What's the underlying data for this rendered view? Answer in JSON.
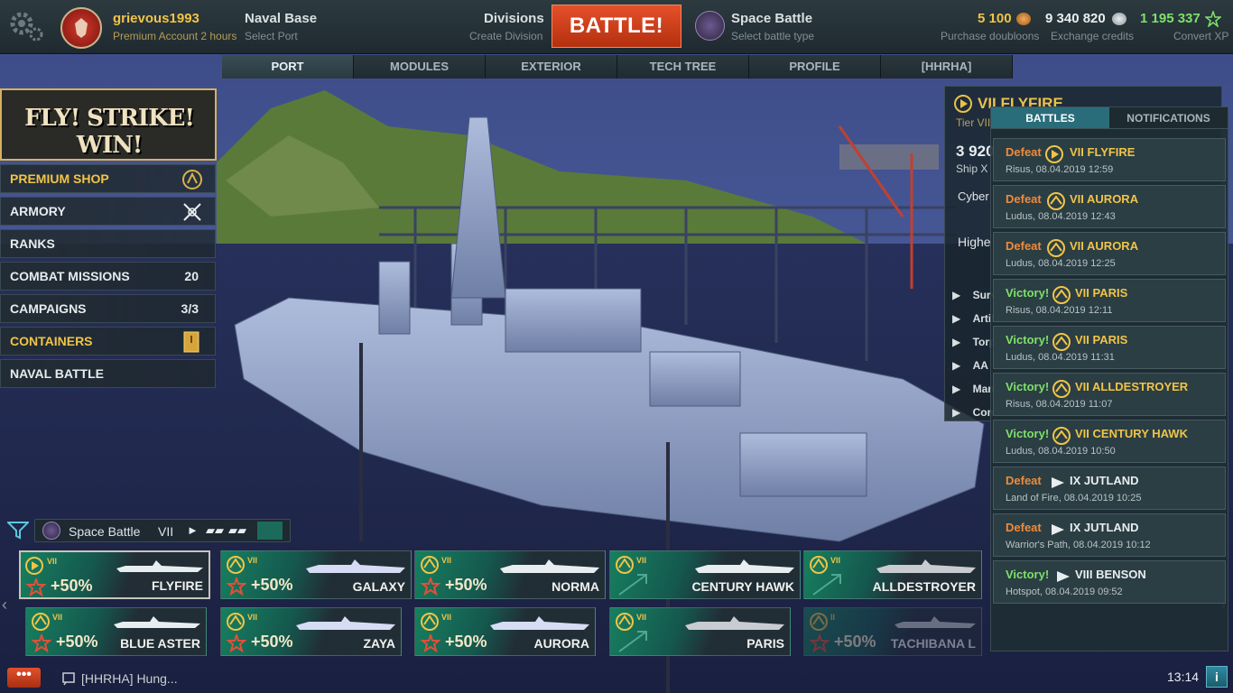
{
  "header": {
    "username": "grievous1993",
    "account_status": "Premium Account 2 hours",
    "port_name": "Naval Base",
    "port_sub": "Select Port",
    "divisions_label": "Divisions",
    "divisions_sub": "Create Division",
    "battle_label": "BATTLE!",
    "battle_type": "Space Battle",
    "battle_type_sub": "Select battle type",
    "doubloons": "5 100",
    "doubloons_label": "Purchase doubloons",
    "credits": "9 340 820",
    "credits_label": "Exchange credits",
    "free_xp": "1 195 337",
    "free_xp_label": "Convert XP"
  },
  "tabs": [
    "PORT",
    "MODULES",
    "EXTERIOR",
    "TECH TREE",
    "PROFILE",
    "[HHRHA]"
  ],
  "promo": {
    "text": "FLY! STRIKE! WIN!"
  },
  "menu": [
    {
      "label": "PREMIUM SHOP",
      "icon": "premium-icon"
    },
    {
      "label": "ARMORY",
      "icon": "armory-icon"
    },
    {
      "label": "RANKS"
    },
    {
      "label": "COMBAT MISSIONS",
      "count": "20"
    },
    {
      "label": "CAMPAIGNS",
      "count": "3/3"
    },
    {
      "label": "CONTAINERS",
      "icon": "container-icon"
    },
    {
      "label": "NAVAL BATTLE"
    }
  ],
  "ship_info": {
    "name": "VII FLYFIRE",
    "tier_text": "Tier VII destro",
    "xp": "3 920",
    "ship_xp_label": "Ship X",
    "commander": "Cyber",
    "highest": "Highe",
    "modules": [
      "Surv",
      "Artil",
      "Torp",
      "AA",
      "Man",
      "Con"
    ]
  },
  "history": {
    "tabs": [
      "BATTLES",
      "NOTIFICATIONS"
    ],
    "rows": [
      {
        "result": "Defeat",
        "ship": "VII FLYFIRE",
        "meta": "Risus, 08.04.2019 12:59"
      },
      {
        "result": "Defeat",
        "ship": "VII AURORA",
        "meta": "Ludus, 08.04.2019 12:43"
      },
      {
        "result": "Defeat",
        "ship": "VII AURORA",
        "meta": "Ludus, 08.04.2019 12:25"
      },
      {
        "result": "Victory!",
        "ship": "VII PARIS",
        "meta": "Risus, 08.04.2019 12:11"
      },
      {
        "result": "Victory!",
        "ship": "VII PARIS",
        "meta": "Ludus, 08.04.2019 11:31"
      },
      {
        "result": "Victory!",
        "ship": "VII ALLDESTROYER",
        "meta": "Risus, 08.04.2019 11:07"
      },
      {
        "result": "Victory!",
        "ship": "VII CENTURY HAWK",
        "meta": "Ludus, 08.04.2019 10:50"
      },
      {
        "result": "Defeat",
        "ship": "IX JUTLAND",
        "meta": "Land of Fire, 08.04.2019 10:25"
      },
      {
        "result": "Defeat",
        "ship": "IX JUTLAND",
        "meta": "Warrior's Path, 08.04.2019 10:12"
      },
      {
        "result": "Victory!",
        "ship": "VIII BENSON",
        "meta": "Hotspot, 08.04.2019 09:52"
      }
    ]
  },
  "filter": {
    "mode": "Space Battle",
    "tier": "VII"
  },
  "carousel": [
    {
      "name": "FLYFIRE",
      "tier": "VII",
      "bonus": "+50%"
    },
    {
      "name": "GALAXY",
      "tier": "VII",
      "bonus": "+50%"
    },
    {
      "name": "NORMA",
      "tier": "VII",
      "bonus": "+50%"
    },
    {
      "name": "CENTURY HAWK",
      "tier": "VII",
      "bonus": ""
    },
    {
      "name": "ALLDESTROYER",
      "tier": "VII",
      "bonus": ""
    },
    {
      "name": "BLUE ASTER",
      "tier": "VII",
      "bonus": "+50%"
    },
    {
      "name": "ZAYA",
      "tier": "VII",
      "bonus": "+50%"
    },
    {
      "name": "AURORA",
      "tier": "VII",
      "bonus": "+50%"
    },
    {
      "name": "PARIS",
      "tier": "VII",
      "bonus": ""
    },
    {
      "name": "TACHIBANA L",
      "tier": "II",
      "bonus": "+50%"
    }
  ],
  "bottom": {
    "chat_label": "•••",
    "chat_text": "[HHRHA] Hung...",
    "clock": "13:14",
    "info_label": "i"
  },
  "colors": {
    "accent_gold": "#f0c447",
    "battle_orange": "#d23f1c",
    "victory_green": "#7ee06a",
    "defeat_orange": "#f08a3a",
    "teal": "#15574e"
  }
}
